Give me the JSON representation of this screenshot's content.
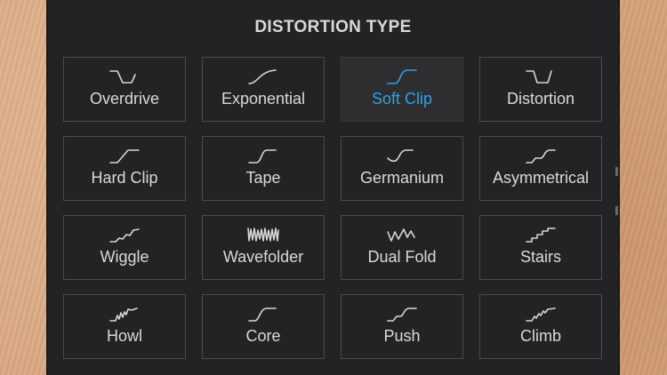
{
  "panel": {
    "title": "DISTORTION TYPE"
  },
  "accent_color": "#29a3e2",
  "types": [
    {
      "label": "Overdrive",
      "icon": "overdrive-curve-icon",
      "selected": false
    },
    {
      "label": "Exponential",
      "icon": "exponential-curve-icon",
      "selected": false
    },
    {
      "label": "Soft Clip",
      "icon": "soft-clip-curve-icon",
      "selected": true
    },
    {
      "label": "Distortion",
      "icon": "distortion-curve-icon",
      "selected": false
    },
    {
      "label": "Hard Clip",
      "icon": "hard-clip-curve-icon",
      "selected": false
    },
    {
      "label": "Tape",
      "icon": "tape-curve-icon",
      "selected": false
    },
    {
      "label": "Germanium",
      "icon": "germanium-curve-icon",
      "selected": false
    },
    {
      "label": "Asymmetrical",
      "icon": "asymmetrical-curve-icon",
      "selected": false
    },
    {
      "label": "Wiggle",
      "icon": "wiggle-curve-icon",
      "selected": false
    },
    {
      "label": "Wavefolder",
      "icon": "wavefolder-curve-icon",
      "selected": false
    },
    {
      "label": "Dual Fold",
      "icon": "dual-fold-curve-icon",
      "selected": false
    },
    {
      "label": "Stairs",
      "icon": "stairs-curve-icon",
      "selected": false
    },
    {
      "label": "Howl",
      "icon": "howl-curve-icon",
      "selected": false
    },
    {
      "label": "Core",
      "icon": "core-curve-icon",
      "selected": false
    },
    {
      "label": "Push",
      "icon": "push-curve-icon",
      "selected": false
    },
    {
      "label": "Climb",
      "icon": "climb-curve-icon",
      "selected": false
    }
  ]
}
